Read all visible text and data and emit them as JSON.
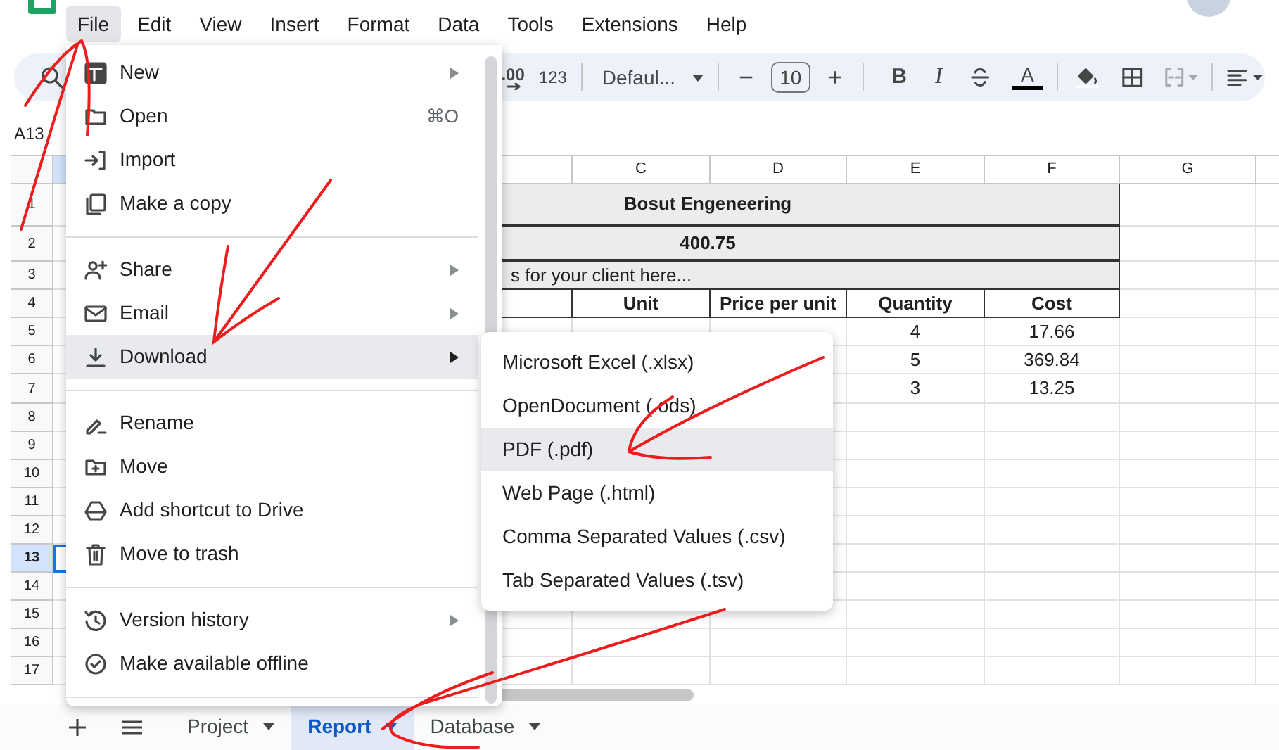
{
  "menu_bar": [
    {
      "label": "File",
      "selected": true
    },
    {
      "label": "Edit",
      "selected": false
    },
    {
      "label": "View",
      "selected": false
    },
    {
      "label": "Insert",
      "selected": false
    },
    {
      "label": "Format",
      "selected": false
    },
    {
      "label": "Data",
      "selected": false
    },
    {
      "label": "Tools",
      "selected": false
    },
    {
      "label": "Extensions",
      "selected": false
    },
    {
      "label": "Help",
      "selected": false
    }
  ],
  "toolbar": {
    "decimal": ".00",
    "number_format": "123",
    "font": "Defaul...",
    "minus": "−",
    "font_size": "10",
    "plus": "+",
    "bold": "B",
    "italic": "I",
    "text_color": "A"
  },
  "name_box": "A13",
  "sheet": {
    "columns": [
      {
        "selected": true
      },
      {
        "selected": false
      },
      {
        "label": "C",
        "selected": false
      },
      {
        "label": "D",
        "selected": false
      },
      {
        "label": "E",
        "selected": false
      },
      {
        "label": "F",
        "selected": false
      },
      {
        "label": "G",
        "selected": false
      }
    ],
    "rows": [
      {
        "header": "1",
        "kind": "title",
        "text": "Bosut Engeneering",
        "selected": false
      },
      {
        "header": "2",
        "kind": "title",
        "text": "400.75",
        "selected": false
      },
      {
        "header": "3",
        "kind": "note",
        "text": "s for your client here...",
        "selected": false
      },
      {
        "header": "4",
        "kind": "table_header",
        "cells": [
          "Unit",
          "Price per unit",
          "Quantity",
          "Cost"
        ],
        "selected": false
      },
      {
        "header": "5",
        "kind": "data",
        "e": "4",
        "f": "17.66",
        "selected": false
      },
      {
        "header": "6",
        "kind": "data",
        "e": "5",
        "f": "369.84",
        "selected": false
      },
      {
        "header": "7",
        "kind": "data",
        "e": "3",
        "f": "13.25",
        "selected": false
      },
      {
        "header": "8",
        "kind": "empty",
        "selected": false
      },
      {
        "header": "9",
        "kind": "empty",
        "selected": false
      },
      {
        "header": "10",
        "kind": "empty",
        "selected": false
      },
      {
        "header": "11",
        "kind": "empty",
        "selected": false
      },
      {
        "header": "12",
        "kind": "empty",
        "selected": false
      },
      {
        "header": "13",
        "kind": "empty",
        "selected": true
      },
      {
        "header": "14",
        "kind": "empty",
        "selected": false
      },
      {
        "header": "15",
        "kind": "empty",
        "selected": false
      },
      {
        "header": "16",
        "kind": "empty",
        "selected": false
      },
      {
        "header": "17",
        "kind": "empty",
        "selected": false
      }
    ]
  },
  "file_menu": [
    {
      "kind": "item",
      "label": "New",
      "submenu": true,
      "selected": false
    },
    {
      "kind": "item",
      "label": "Open",
      "shortcut": "⌘O",
      "submenu": false,
      "selected": false
    },
    {
      "kind": "item",
      "label": "Import",
      "submenu": false,
      "selected": false
    },
    {
      "kind": "item",
      "label": "Make a copy",
      "submenu": false,
      "selected": false
    },
    {
      "kind": "divider"
    },
    {
      "kind": "item",
      "label": "Share",
      "submenu": true,
      "selected": false
    },
    {
      "kind": "item",
      "label": "Email",
      "submenu": true,
      "selected": false
    },
    {
      "kind": "item",
      "label": "Download",
      "submenu": true,
      "selected": true
    },
    {
      "kind": "divider"
    },
    {
      "kind": "item",
      "label": "Rename",
      "submenu": false,
      "selected": false
    },
    {
      "kind": "item",
      "label": "Move",
      "submenu": false,
      "selected": false
    },
    {
      "kind": "item",
      "label": "Add shortcut to Drive",
      "submenu": false,
      "selected": false
    },
    {
      "kind": "item",
      "label": "Move to trash",
      "submenu": false,
      "selected": false
    },
    {
      "kind": "divider"
    },
    {
      "kind": "item",
      "label": "Version history",
      "submenu": true,
      "selected": false
    },
    {
      "kind": "item",
      "label": "Make available offline",
      "submenu": false,
      "selected": false
    },
    {
      "kind": "divider"
    }
  ],
  "download_submenu": [
    {
      "label": "Microsoft Excel (.xlsx)",
      "selected": false
    },
    {
      "label": "OpenDocument (.ods)",
      "selected": false
    },
    {
      "label": "PDF (.pdf)",
      "selected": true
    },
    {
      "label": "Web Page (.html)",
      "selected": false
    },
    {
      "label": "Comma Separated Values (.csv)",
      "selected": false
    },
    {
      "label": "Tab Separated Values (.tsv)",
      "selected": false
    }
  ],
  "sheet_tabs": [
    {
      "label": "Project",
      "selected": false
    },
    {
      "label": "Report",
      "selected": true
    },
    {
      "label": "Database",
      "selected": false
    }
  ]
}
